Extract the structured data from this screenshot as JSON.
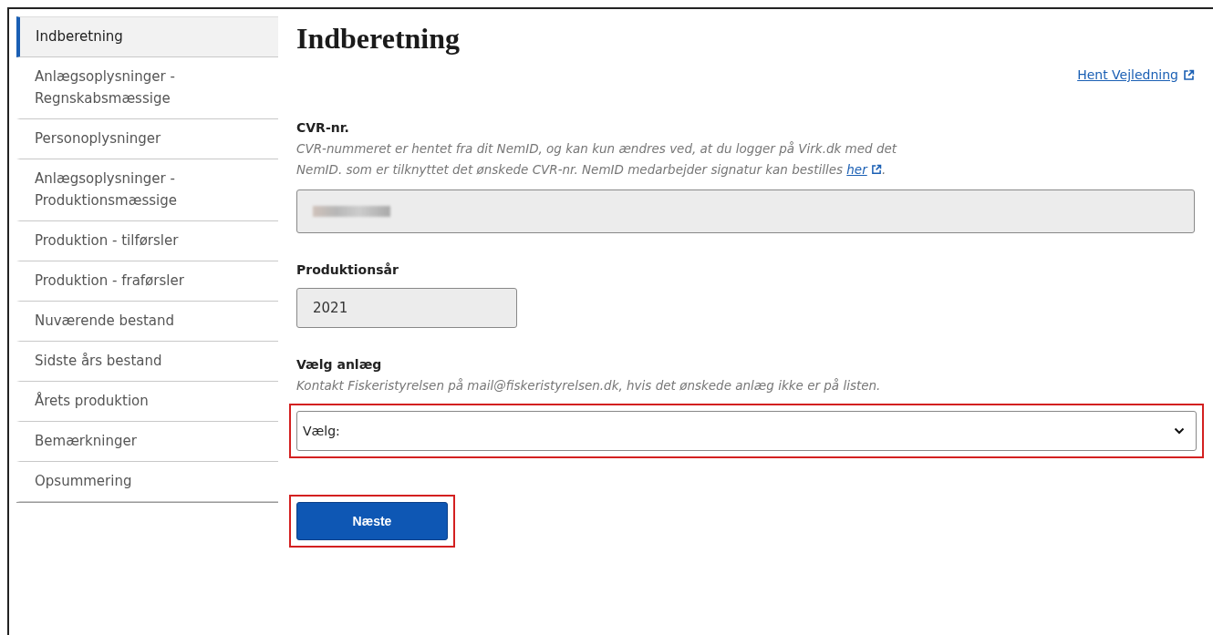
{
  "sidebar": {
    "items": [
      {
        "label": "Indberetning",
        "selected": true
      },
      {
        "label": "Anlægsoplysninger - Regnskabsmæssige",
        "selected": false
      },
      {
        "label": "Personoplysninger",
        "selected": false
      },
      {
        "label": "Anlægsoplysninger - Produktionsmæssige",
        "selected": false
      },
      {
        "label": "Produktion - tilførsler",
        "selected": false
      },
      {
        "label": "Produktion - fraførsler",
        "selected": false
      },
      {
        "label": "Nuværende bestand",
        "selected": false
      },
      {
        "label": "Sidste års bestand",
        "selected": false
      },
      {
        "label": "Årets produktion",
        "selected": false
      },
      {
        "label": "Bemærkninger",
        "selected": false
      },
      {
        "label": "Opsummering",
        "selected": false
      }
    ]
  },
  "page": {
    "title": "Indberetning",
    "guide_link": "Hent Vejledning"
  },
  "cvr": {
    "label": "CVR-nr.",
    "hint_before": "CVR-nummeret er hentet fra dit NemID, og kan kun ændres ved, at du logger på Virk.dk med det NemID. som er tilknyttet det ønskede CVR-nr. NemID medarbejder signatur kan bestilles",
    "hint_link": "her",
    "hint_after": ".",
    "redacted": true
  },
  "year": {
    "label": "Produktionsår",
    "value": "2021"
  },
  "facility": {
    "label": "Vælg anlæg",
    "hint": "Kontakt Fiskeristyrelsen på mail@fiskeristyrelsen.dk, hvis det ønskede anlæg ikke er på listen.",
    "value": "Vælg:",
    "highlighted": true
  },
  "next_button": {
    "label": "Næste",
    "highlighted": true
  }
}
